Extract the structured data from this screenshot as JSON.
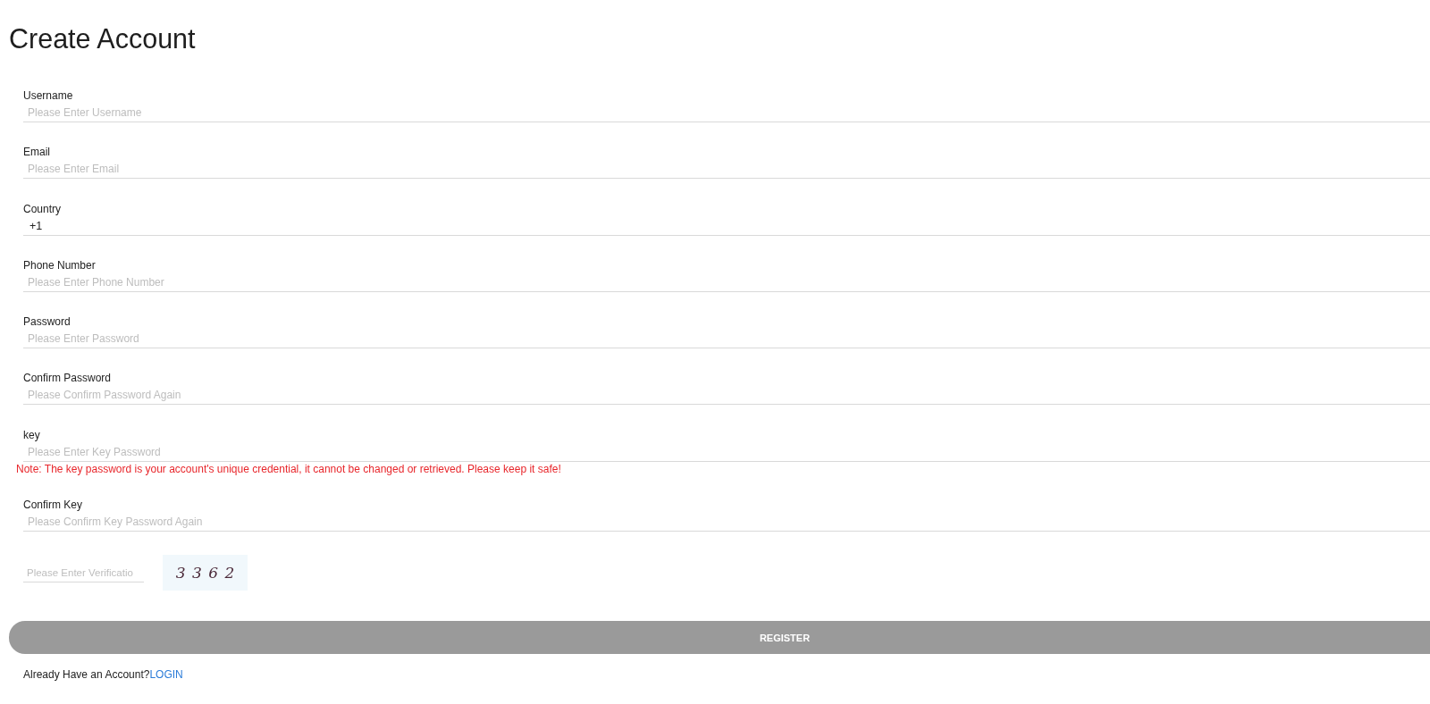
{
  "page": {
    "title": "Create Account"
  },
  "fields": [
    {
      "kind": "text",
      "label": "Username",
      "placeholder": "Please Enter Username"
    },
    {
      "kind": "text",
      "label": "Email",
      "placeholder": "Please Enter Email"
    },
    {
      "kind": "select",
      "label": "Country",
      "value": "+1"
    },
    {
      "kind": "text",
      "label": "Phone Number",
      "placeholder": "Please Enter Phone Number"
    },
    {
      "kind": "text",
      "label": "Password",
      "placeholder": "Please Enter Password"
    },
    {
      "kind": "text",
      "label": "Confirm Password",
      "placeholder": "Please Confirm Password Again"
    },
    {
      "kind": "text",
      "label": "key",
      "placeholder": "Please Enter Key Password",
      "note": "Note: The key password is your account's unique credential, it cannot be changed or retrieved. Please keep it safe!"
    },
    {
      "kind": "text",
      "label": "Confirm Key",
      "placeholder": "Please Confirm Key Password Again"
    }
  ],
  "verification": {
    "placeholder": "Please Enter Verificatio",
    "captcha": "3 3 6 2"
  },
  "register_button": {
    "label": "REGISTER"
  },
  "footer": {
    "text": "Already Have an Account?",
    "link": "LOGIN"
  }
}
